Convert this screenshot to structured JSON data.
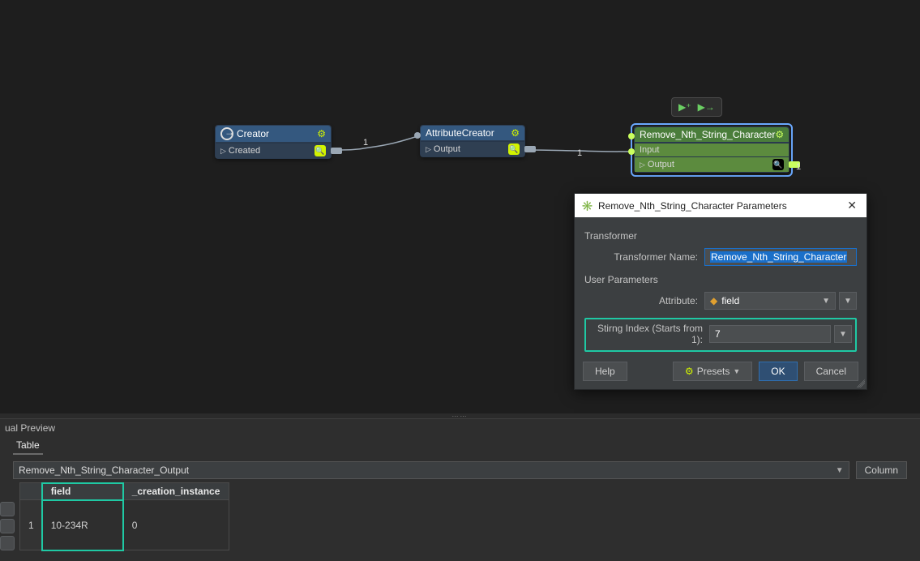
{
  "canvas": {
    "edge_counts": {
      "e1": "1",
      "e2": "1",
      "e3": "1"
    },
    "nodes": {
      "creator": {
        "title": "Creator",
        "port_out": "Created"
      },
      "attrcreator": {
        "title": "AttributeCreator",
        "port_out": "Output"
      },
      "remove": {
        "title": "Remove_Nth_String_Character",
        "port_in": "Input",
        "port_out": "Output"
      }
    }
  },
  "dialog": {
    "title": "Remove_Nth_String_Character Parameters",
    "section_transformer": "Transformer",
    "row_transformer_name_label": "Transformer Name:",
    "transformer_name_value": "Remove_Nth_String_Character",
    "section_user_params": "User Parameters",
    "row_attribute_label": "Attribute:",
    "attribute_value": "field",
    "row_index_label": "Stirng Index (Starts from 1):",
    "index_value": "7",
    "btn_help": "Help",
    "btn_presets": "Presets",
    "btn_ok": "OK",
    "btn_cancel": "Cancel"
  },
  "preview": {
    "panel_title": "ual Preview",
    "tab_table": "Table",
    "source_value": "Remove_Nth_String_Character_Output",
    "columns_btn": "Column",
    "headers": {
      "field": "field",
      "creation_instance": "_creation_instance"
    },
    "rows": [
      {
        "idx": "1",
        "field": "10-234R",
        "creation_instance": "0"
      }
    ]
  }
}
